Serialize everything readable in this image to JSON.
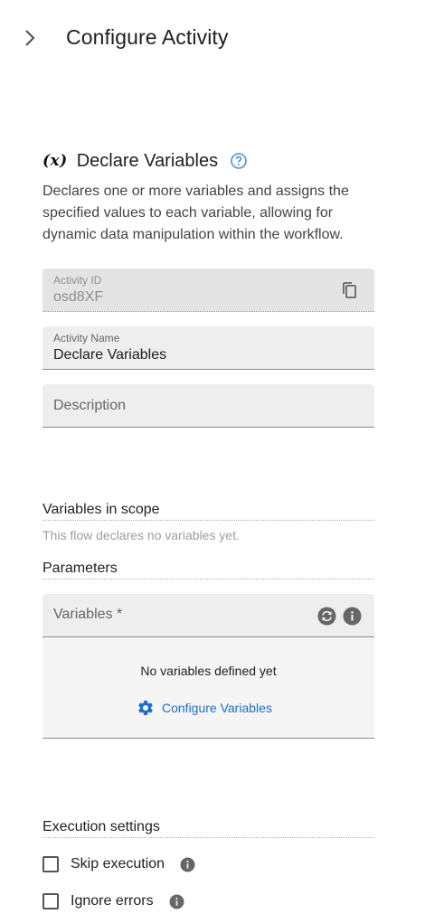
{
  "header": {
    "title": "Configure Activity"
  },
  "activity": {
    "title": "Declare Variables",
    "description": "Declares one or more variables and assigns the specified values to each variable, allowing for dynamic data manipulation within the workflow."
  },
  "fields": {
    "activity_id": {
      "label": "Activity ID",
      "value": "osd8XF"
    },
    "activity_name": {
      "label": "Activity Name",
      "value": "Declare Variables"
    },
    "description": {
      "placeholder": "Description"
    }
  },
  "scope": {
    "title": "Variables in scope",
    "hint": "This flow declares no variables yet."
  },
  "parameters": {
    "title": "Parameters",
    "variables_label": "Variables *",
    "empty_text": "No variables defined yet",
    "configure_label": "Configure Variables"
  },
  "execution": {
    "title": "Execution settings",
    "skip_label": "Skip execution",
    "ignore_label": "Ignore errors"
  },
  "colors": {
    "accent": "#1a6fd0",
    "help_icon": "#4a90d9"
  }
}
